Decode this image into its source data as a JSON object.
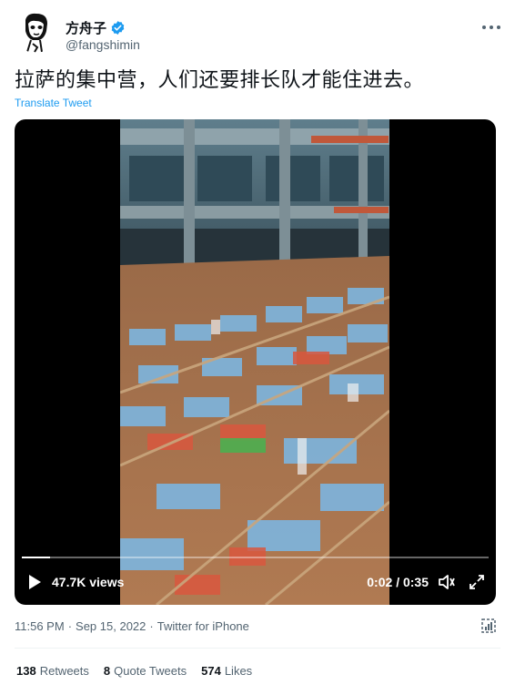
{
  "author": {
    "display_name": "方舟子",
    "handle": "@fangshimin",
    "verified_icon": "verified-badge-icon",
    "avatar": "avatar-caricature"
  },
  "tweet": {
    "text": "拉萨的集中营，人们还要排长队才能住进去。",
    "translate_label": "Translate Tweet"
  },
  "video": {
    "views": "47.7K views",
    "current_time": "0:02",
    "separator": "/",
    "duration": "0:35",
    "progress_fraction": 0.06,
    "icons": [
      "play-icon",
      "volume-icon",
      "fullscreen-icon"
    ]
  },
  "meta": {
    "time": "11:56 PM",
    "sep1": "·",
    "date": "Sep 15, 2022",
    "sep2": "·",
    "source": "Twitter for iPhone"
  },
  "stats": {
    "retweets_count": "138",
    "retweets_label": "Retweets",
    "quotes_count": "8",
    "quotes_label": "Quote Tweets",
    "likes_count": "574",
    "likes_label": "Likes"
  },
  "colors": {
    "accent": "#1d9bf0",
    "text_primary": "#0f1419",
    "text_secondary": "#536471",
    "divider": "#eff3f4"
  }
}
